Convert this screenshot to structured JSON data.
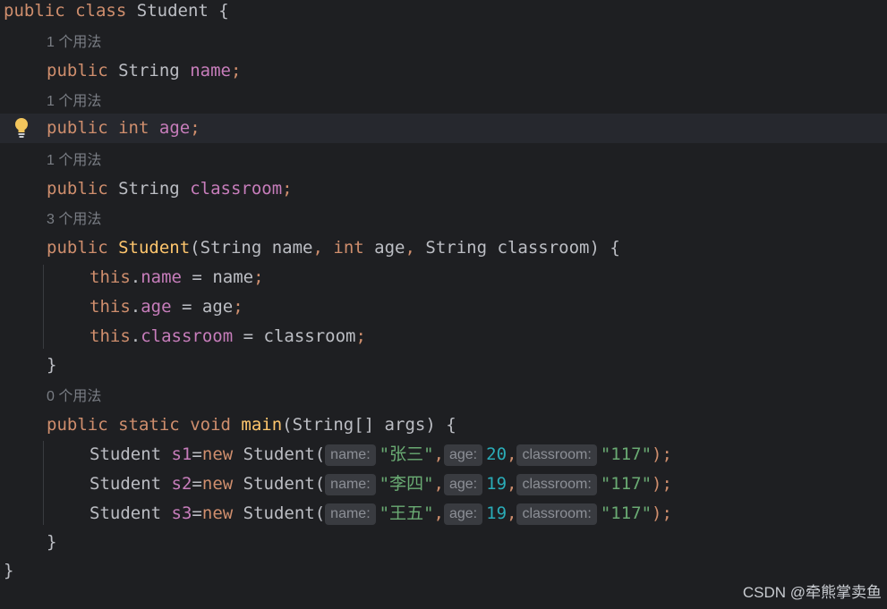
{
  "code": {
    "class_decl": {
      "kw1": "public",
      "kw2": "class",
      "name": "Student",
      "brace": "{"
    },
    "hint1": "1 个用法",
    "field1": {
      "mod": "public",
      "type": "String",
      "name": "name",
      "semi": ";"
    },
    "hint2": "1 个用法",
    "field2": {
      "mod": "public",
      "type": "int",
      "name": "age",
      "semi": ";"
    },
    "hint3": "1 个用法",
    "field3": {
      "mod": "public",
      "type": "String",
      "name": "classroom",
      "semi": ";"
    },
    "hint4": "3 个用法",
    "ctor": {
      "mod": "public",
      "name": "Student",
      "open": "(",
      "p1_type": "String",
      "p1_name": "name",
      "c1": ",",
      "p2_type": "int",
      "p2_name": "age",
      "c2": ",",
      "p3_type": "String",
      "p3_name": "classroom",
      "close": ") {"
    },
    "assign1": {
      "this": "this",
      "dot": ".",
      "field": "name",
      "eq": " = ",
      "val": "name",
      "semi": ";"
    },
    "assign2": {
      "this": "this",
      "dot": ".",
      "field": "age",
      "eq": " = ",
      "val": "age",
      "semi": ";"
    },
    "assign3": {
      "this": "this",
      "dot": ".",
      "field": "classroom",
      "eq": " = ",
      "val": "classroom",
      "semi": ";"
    },
    "ctor_close": "}",
    "hint5": "0 个用法",
    "main": {
      "mod": "public",
      "static": "static",
      "void": "void",
      "name": "main",
      "params": "(String[] args) {"
    },
    "stmts": [
      {
        "type": "Student",
        "var": "s1",
        "eq": "=",
        "new": "new",
        "cls": "Student(",
        "h_name": "name:",
        "v_name": "\"张三\"",
        "h_age": "age:",
        "v_age": "20",
        "h_room": "classroom:",
        "v_room": "\"117\"",
        "end": ");"
      },
      {
        "type": "Student",
        "var": "s2",
        "eq": "=",
        "new": "new",
        "cls": "Student(",
        "h_name": "name:",
        "v_name": "\"李四\"",
        "h_age": "age:",
        "v_age": "19",
        "h_room": "classroom:",
        "v_room": "\"117\"",
        "end": ");"
      },
      {
        "type": "Student",
        "var": "s3",
        "eq": "=",
        "new": "new",
        "cls": "Student(",
        "h_name": "name:",
        "v_name": "\"王五\"",
        "h_age": "age:",
        "v_age": "19",
        "h_room": "classroom:",
        "v_room": "\"117\"",
        "end": ");"
      }
    ],
    "main_close": "}",
    "class_close": "}"
  },
  "icons": {
    "gutter": "lightbulb-icon"
  },
  "watermark": "CSDN @牵熊掌卖鱼"
}
